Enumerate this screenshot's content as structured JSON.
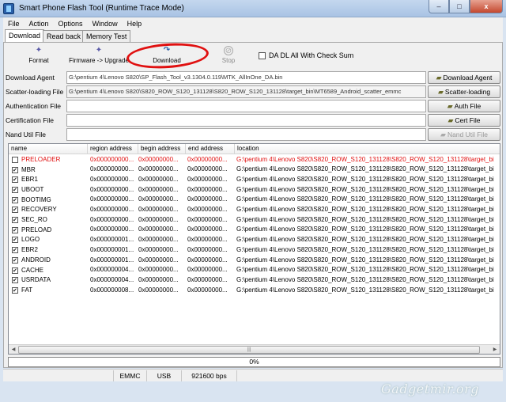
{
  "window": {
    "title": "Smart Phone Flash Tool (Runtime Trace Mode)",
    "controls": [
      "–",
      "□",
      "x"
    ]
  },
  "menu": [
    "File",
    "Action",
    "Options",
    "Window",
    "Help"
  ],
  "tabs": [
    "Download",
    "Read back",
    "Memory Test"
  ],
  "toolbar": {
    "format": "Format",
    "firmware_upgrade": "Firmware -> Upgrade",
    "download": "Download",
    "stop": "Stop",
    "da_dl_all": "DA DL All With Check Sum",
    "da_dl_all_checked": false
  },
  "fields": [
    {
      "label": "Download Agent",
      "value": "G:\\pentium 4\\Lenovo S820\\SP_Flash_Tool_v3.1304.0.119\\MTK_AllInOne_DA.bin",
      "button": "Download Agent",
      "button_icon": "folder-icon",
      "button_disabled": false
    },
    {
      "label": "Scatter-loading File",
      "value": "G:\\pentium 4\\Lenovo S820\\S820_ROW_S120_131128\\S820_ROW_S120_131128\\target_bin\\MT6589_Android_scatter_emmc",
      "button": "Scatter-loading",
      "button_icon": "folder-icon",
      "button_disabled": false
    },
    {
      "label": "Authentication File",
      "value": "",
      "button": "Auth File",
      "button_icon": "folder-icon",
      "button_disabled": false
    },
    {
      "label": "Certification File",
      "value": "",
      "button": "Cert File",
      "button_icon": "folder-icon",
      "button_disabled": false
    },
    {
      "label": "Nand Util File",
      "value": "",
      "button": "Nand Util File",
      "button_icon": "folder-icon",
      "button_disabled": true
    }
  ],
  "table": {
    "headers": [
      "name",
      "region address",
      "begin address",
      "end address",
      "location"
    ],
    "rows": [
      {
        "name": "PRELOADER",
        "checked": false,
        "region": "0x000000000...",
        "begin": "0x00000000...",
        "end": "0x00000000...",
        "location": "G:\\pentium 4\\Lenovo S820\\S820_ROW_S120_131128\\S820_ROW_S120_131128\\target_bi",
        "highlight": true
      },
      {
        "name": "MBR",
        "checked": true,
        "region": "0x000000000...",
        "begin": "0x00000000...",
        "end": "0x00000000...",
        "location": "G:\\pentium 4\\Lenovo S820\\S820_ROW_S120_131128\\S820_ROW_S120_131128\\target_bi",
        "highlight": false
      },
      {
        "name": "EBR1",
        "checked": true,
        "region": "0x000000000...",
        "begin": "0x00000000...",
        "end": "0x00000000...",
        "location": "G:\\pentium 4\\Lenovo S820\\S820_ROW_S120_131128\\S820_ROW_S120_131128\\target_bi",
        "highlight": false
      },
      {
        "name": "UBOOT",
        "checked": true,
        "region": "0x000000000...",
        "begin": "0x00000000...",
        "end": "0x00000000...",
        "location": "G:\\pentium 4\\Lenovo S820\\S820_ROW_S120_131128\\S820_ROW_S120_131128\\target_bi",
        "highlight": false
      },
      {
        "name": "BOOTIMG",
        "checked": true,
        "region": "0x000000000...",
        "begin": "0x00000000...",
        "end": "0x00000000...",
        "location": "G:\\pentium 4\\Lenovo S820\\S820_ROW_S120_131128\\S820_ROW_S120_131128\\target_bi",
        "highlight": false
      },
      {
        "name": "RECOVERY",
        "checked": true,
        "region": "0x000000000...",
        "begin": "0x00000000...",
        "end": "0x00000000...",
        "location": "G:\\pentium 4\\Lenovo S820\\S820_ROW_S120_131128\\S820_ROW_S120_131128\\target_bi",
        "highlight": false
      },
      {
        "name": "SEC_RO",
        "checked": true,
        "region": "0x000000000...",
        "begin": "0x00000000...",
        "end": "0x00000000...",
        "location": "G:\\pentium 4\\Lenovo S820\\S820_ROW_S120_131128\\S820_ROW_S120_131128\\target_bi",
        "highlight": false
      },
      {
        "name": "PRELOAD",
        "checked": true,
        "region": "0x000000000...",
        "begin": "0x00000000...",
        "end": "0x00000000...",
        "location": "G:\\pentium 4\\Lenovo S820\\S820_ROW_S120_131128\\S820_ROW_S120_131128\\target_bi",
        "highlight": false
      },
      {
        "name": "LOGO",
        "checked": true,
        "region": "0x000000001...",
        "begin": "0x00000000...",
        "end": "0x00000000...",
        "location": "G:\\pentium 4\\Lenovo S820\\S820_ROW_S120_131128\\S820_ROW_S120_131128\\target_bi",
        "highlight": false
      },
      {
        "name": "EBR2",
        "checked": true,
        "region": "0x000000001...",
        "begin": "0x00000000...",
        "end": "0x00000000...",
        "location": "G:\\pentium 4\\Lenovo S820\\S820_ROW_S120_131128\\S820_ROW_S120_131128\\target_bi",
        "highlight": false
      },
      {
        "name": "ANDROID",
        "checked": true,
        "region": "0x000000001...",
        "begin": "0x00000000...",
        "end": "0x00000000...",
        "location": "G:\\pentium 4\\Lenovo S820\\S820_ROW_S120_131128\\S820_ROW_S120_131128\\target_bi",
        "highlight": false
      },
      {
        "name": "CACHE",
        "checked": true,
        "region": "0x000000004...",
        "begin": "0x00000000...",
        "end": "0x00000000...",
        "location": "G:\\pentium 4\\Lenovo S820\\S820_ROW_S120_131128\\S820_ROW_S120_131128\\target_bi",
        "highlight": false
      },
      {
        "name": "USRDATA",
        "checked": true,
        "region": "0x000000004...",
        "begin": "0x00000000...",
        "end": "0x00000000...",
        "location": "G:\\pentium 4\\Lenovo S820\\S820_ROW_S120_131128\\S820_ROW_S120_131128\\target_bi",
        "highlight": false
      },
      {
        "name": "FAT",
        "checked": true,
        "region": "0x000000008...",
        "begin": "0x00000000...",
        "end": "0x00000000...",
        "location": "G:\\pentium 4\\Lenovo S820\\S820_ROW_S120_131128\\S820_ROW_S120_131128\\target_bi",
        "highlight": false
      }
    ]
  },
  "progress": {
    "text": "0%",
    "fraction": 0
  },
  "status": [
    "",
    "EMMC",
    "USB",
    "921600 bps",
    ""
  ],
  "watermark": "Gadgetmir.org",
  "colors": {
    "highlight_row": "#e01010",
    "annotation_circle": "#e01010"
  }
}
